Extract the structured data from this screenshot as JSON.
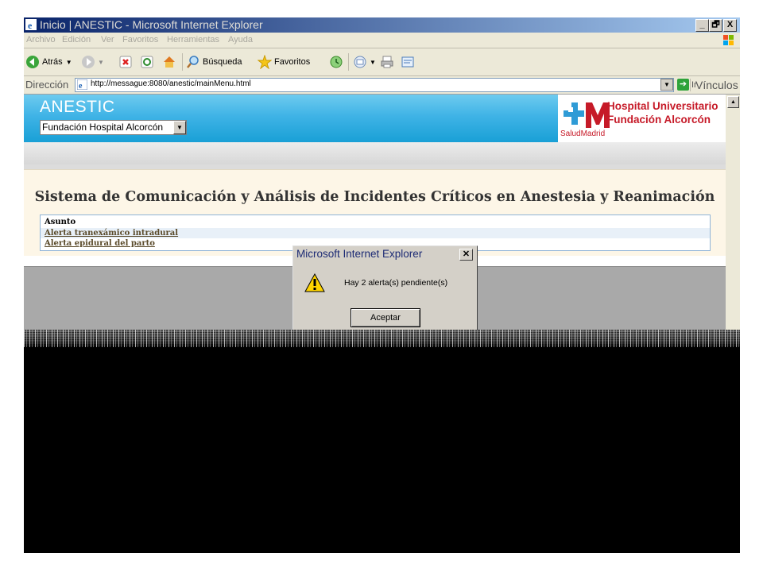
{
  "window": {
    "title": "Inicio | ANESTIC - Microsoft Internet Explorer",
    "controls": [
      "_",
      "🗗",
      "X"
    ]
  },
  "menu": [
    "Archivo",
    "Edición",
    "Ver",
    "Favoritos",
    "Herramientas",
    "Ayuda"
  ],
  "toolbar": {
    "back": "Atrás",
    "search": "Búsqueda",
    "favorites": "Favoritos"
  },
  "address": {
    "label": "Dirección",
    "url": "http://messague:8080/anestic/mainMenu.html",
    "go": "Ir",
    "links": "Vínculos"
  },
  "banner": {
    "app_name": "ANESTIC",
    "hospital_select": "Fundación Hospital Alcorcón"
  },
  "logo": {
    "line1": "Hospital Universitario",
    "line2": "Fundación Alcorcón",
    "salud": "SaludMadrid"
  },
  "main": {
    "heading": "Sistema de Comunicación y Análisis de Incidentes Críticos en Anestesia y Reanimación",
    "table": {
      "header": "Asunto",
      "rows": [
        "Alerta tranexámico intradural",
        "Alerta epidural del parto"
      ]
    }
  },
  "dialog": {
    "title": "Microsoft Internet Explorer",
    "message": "Hay 2 alerta(s) pendiente(s)",
    "ok": "Aceptar"
  },
  "colors": {
    "titlebar": "#0a246a",
    "banner": "#19a0d6",
    "logo_red": "#c61a28",
    "panel": "#fdf6e7"
  }
}
